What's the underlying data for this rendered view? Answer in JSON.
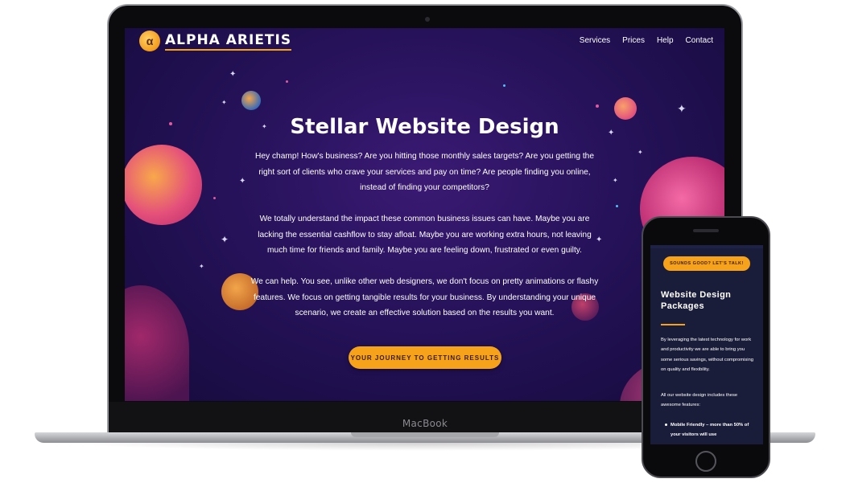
{
  "brand": {
    "name": "ALPHA ARIETIS",
    "logo_glyph": "α"
  },
  "nav": {
    "items": [
      "Services",
      "Prices",
      "Help",
      "Contact"
    ]
  },
  "hero": {
    "title": "Stellar Website Design",
    "paragraphs": [
      "Hey champ! How's business? Are you hitting those monthly sales targets? Are you getting the right sort of clients who crave your services and pay on time? Are people finding you online, instead of finding your competitors?",
      "We totally understand the impact these common business issues can have. Maybe you are lacking the essential cashflow to stay afloat. Maybe you are working extra hours, not leaving much time for friends and family. Maybe you are feeling down, frustrated or even guilty.",
      "We can help. You see, unlike other web designers, we don't focus on pretty animations or flashy features. We focus on getting tangible results for your business. By understanding your unique scenario, we create an effective solution based on the results you want."
    ],
    "cta_label": "YOUR JOURNEY TO GETTING RESULTS"
  },
  "device": {
    "laptop_label": "MacBook"
  },
  "mobile": {
    "cta_label": "SOUNDS GOOD? LET'S TALK!",
    "title": "Website Design Packages",
    "paragraph1": "By leveraging the latest technology for work and productivity we are able to bring you some serious savings, without compromising on quality and flexibility.",
    "paragraph2": "All our website design includes these awesome features:",
    "bullet1": "Mobile Friendly – more than 50% of your visitors will use"
  },
  "colors": {
    "accent": "#f7a21b",
    "hero_bg": "#26125a",
    "mobile_bg": "#1a1d3a"
  }
}
